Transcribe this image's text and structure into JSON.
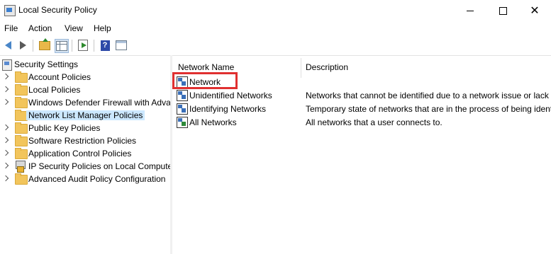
{
  "window": {
    "title": "Local Security Policy"
  },
  "menu": [
    "File",
    "Action",
    "View",
    "Help"
  ],
  "tree": {
    "root": "Security Settings",
    "items": [
      {
        "label": "Account Policies",
        "selected": false
      },
      {
        "label": "Local Policies",
        "selected": false
      },
      {
        "label": "Windows Defender Firewall with Adva",
        "selected": false
      },
      {
        "label": "Network List Manager Policies",
        "selected": true
      },
      {
        "label": "Public Key Policies",
        "selected": false
      },
      {
        "label": "Software Restriction Policies",
        "selected": false
      },
      {
        "label": "Application Control Policies",
        "selected": false
      },
      {
        "label": "IP Security Policies on Local Compute",
        "selected": false
      },
      {
        "label": "Advanced Audit Policy Configuration",
        "selected": false
      }
    ]
  },
  "list": {
    "columns": [
      "Network Name",
      "Description"
    ],
    "rows": [
      {
        "name": "Network",
        "description": ""
      },
      {
        "name": "Unidentified Networks",
        "description": "Networks that cannot be identified due to a network issue or lack"
      },
      {
        "name": "Identifying Networks",
        "description": "Temporary state of networks that are in the process of being ident"
      },
      {
        "name": "All Networks",
        "description": "All networks that a user connects to."
      }
    ]
  },
  "colors": {
    "selection": "#cce8ff",
    "highlight": "#e03030"
  }
}
